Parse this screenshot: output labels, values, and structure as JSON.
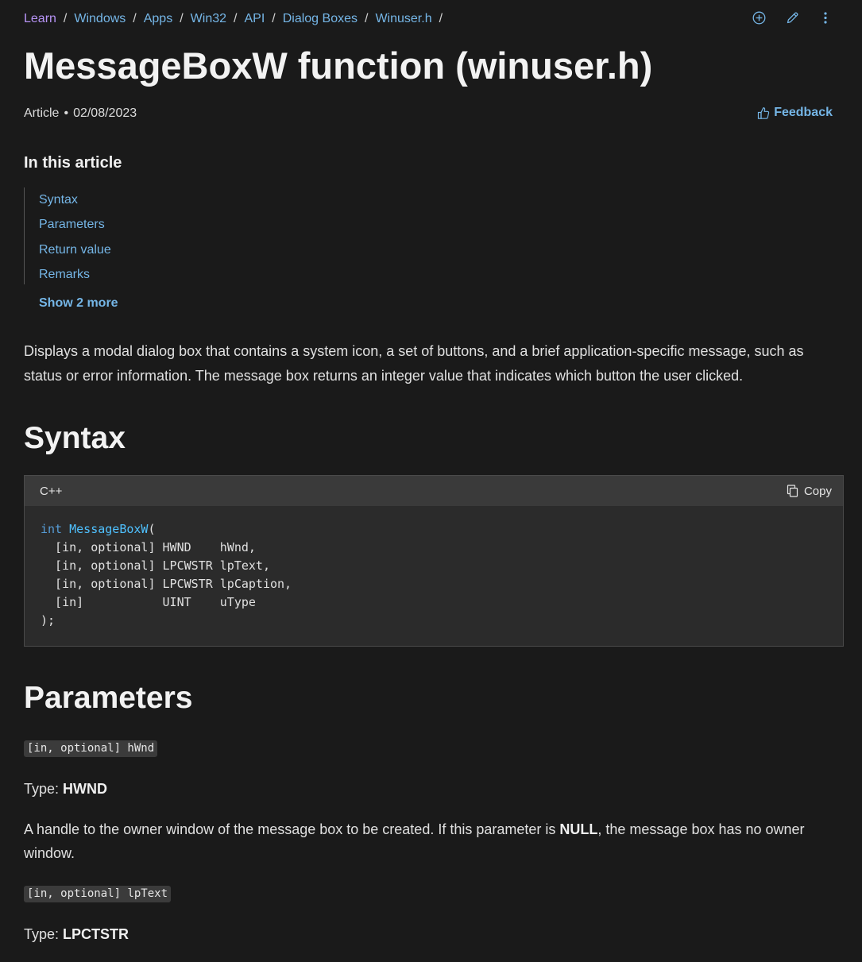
{
  "breadcrumb": [
    {
      "label": "Learn"
    },
    {
      "label": "Windows"
    },
    {
      "label": "Apps"
    },
    {
      "label": "Win32"
    },
    {
      "label": "API"
    },
    {
      "label": "Dialog Boxes"
    },
    {
      "label": "Winuser.h"
    }
  ],
  "breadcrumb_separator": "/",
  "top_actions": [
    "add-circle-icon",
    "pencil-icon",
    "more-vertical-icon"
  ],
  "title": "MessageBoxW function (winuser.h)",
  "meta": {
    "type": "Article",
    "dot": "•",
    "date": "02/08/2023"
  },
  "feedback_label": "Feedback",
  "toc": {
    "title": "In this article",
    "items": [
      "Syntax",
      "Parameters",
      "Return value",
      "Remarks"
    ],
    "show_more": "Show 2 more"
  },
  "description": "Displays a modal dialog box that contains a system icon, a set of buttons, and a brief application-specific message, such as status or error information. The message box returns an integer value that indicates which button the user clicked.",
  "syntax": {
    "heading": "Syntax",
    "language": "C++",
    "copy_label": "Copy",
    "return_type": "int",
    "function_name": "MessageBoxW",
    "open_paren": "(",
    "lines": [
      "  [in, optional] HWND    hWnd,",
      "  [in, optional] LPCWSTR lpText,",
      "  [in, optional] LPCWSTR lpCaption,",
      "  [in]           UINT    uType",
      ");"
    ]
  },
  "parameters": {
    "heading": "Parameters",
    "type_prefix": "Type: ",
    "items": [
      {
        "tag": "[in, optional] hWnd",
        "type": "HWND",
        "desc_before": "A handle to the owner window of the message box to be created. If this parameter is ",
        "desc_bold": "NULL",
        "desc_after": ", the message box has no owner window."
      },
      {
        "tag": "[in, optional] lpText",
        "type": "LPCTSTR"
      }
    ]
  },
  "colors": {
    "background": "#1a1a1a",
    "link": "#75b6e7",
    "first_crumb": "#b794f6",
    "code_keyword": "#569cd6",
    "code_function": "#4fc1ff"
  }
}
